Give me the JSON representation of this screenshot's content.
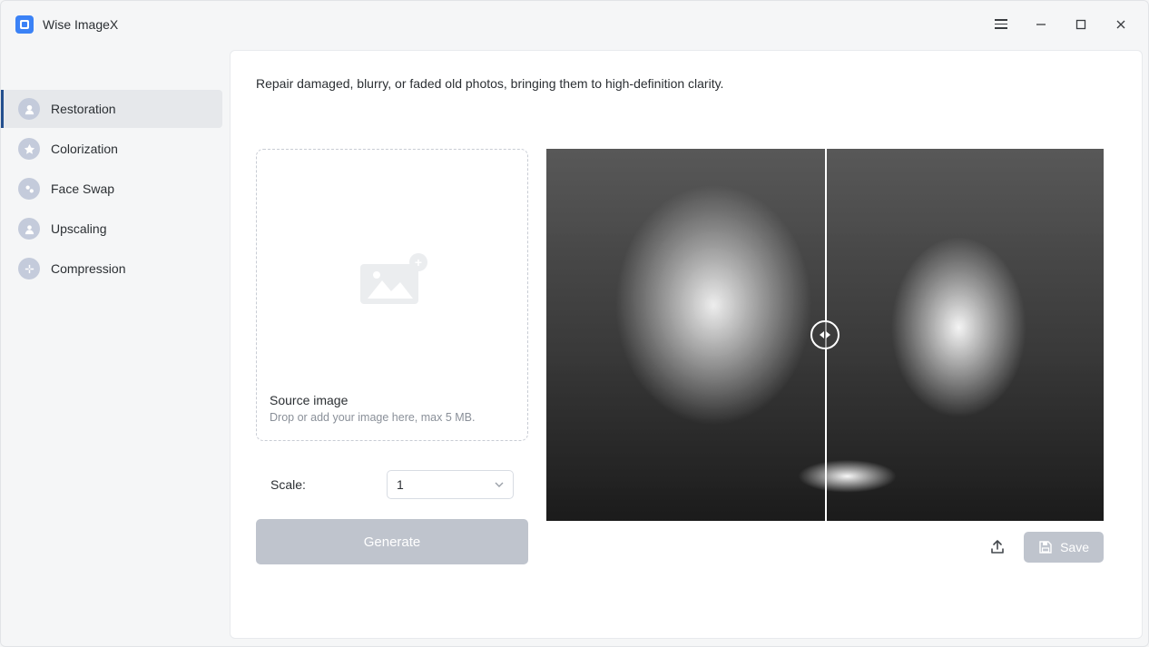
{
  "app": {
    "title": "Wise ImageX"
  },
  "sidebar": {
    "items": [
      {
        "label": "Restoration"
      },
      {
        "label": "Colorization"
      },
      {
        "label": "Face Swap"
      },
      {
        "label": "Upscaling"
      },
      {
        "label": "Compression"
      }
    ]
  },
  "main": {
    "description": "Repair damaged, blurry, or faded old photos, bringing them to high-definition clarity.",
    "dropzone": {
      "title": "Source image",
      "subtitle": "Drop or add your image here, max 5 MB."
    },
    "scale": {
      "label": "Scale:",
      "value": "1"
    },
    "generate_label": "Generate",
    "save_label": "Save"
  }
}
